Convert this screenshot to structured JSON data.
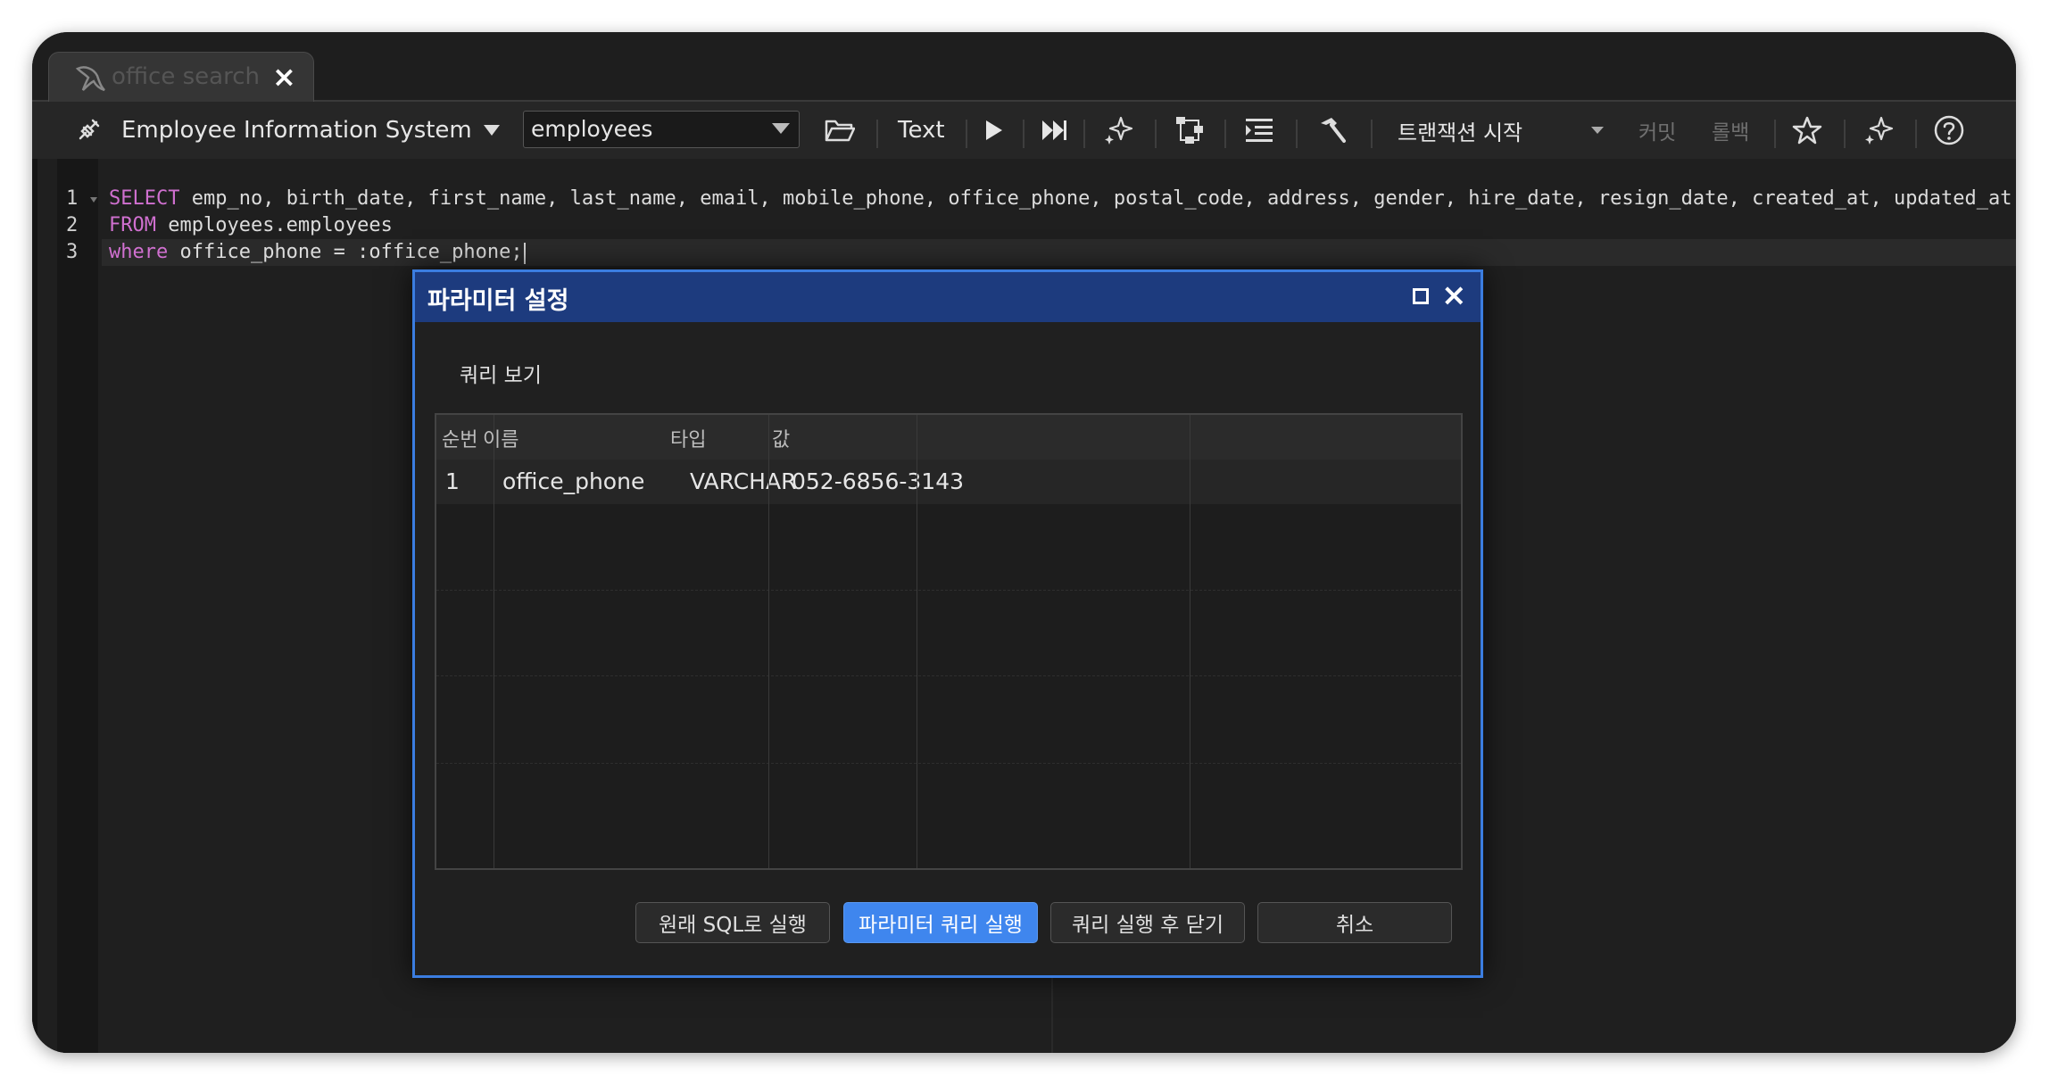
{
  "tab": {
    "title": "office search",
    "icon": "dolphin-icon"
  },
  "toolbar": {
    "connection": "Employee Information System",
    "database": "employees",
    "format": "Text",
    "transaction": "트랜잭션 시작",
    "commit": "커밋",
    "rollback": "롤백"
  },
  "editor": {
    "lines": [
      {
        "num": "1",
        "kw": "SELECT",
        "rest": " emp_no, birth_date, first_name, last_name, email, mobile_phone, office_phone, postal_code, address, gender, hire_date, resign_date, created_at, updated_at"
      },
      {
        "num": "2",
        "kw": "FROM",
        "rest": " employees.employees"
      },
      {
        "num": "3",
        "kw": "where",
        "rest": " office_phone = :office_phone;"
      }
    ]
  },
  "dialog": {
    "title": "파라미터 설정",
    "query_view_label": "쿼리 보기",
    "columns": [
      "순번",
      "이름",
      "타입",
      "값",
      ""
    ],
    "rows": [
      {
        "seq": "1",
        "name": "office_phone",
        "type": "VARCHAR",
        "value": "052-6856-3143"
      }
    ],
    "buttons": {
      "run_original": "원래 SQL로 실행",
      "run_param": "파라미터 쿼리 실행",
      "run_close": "쿼리 실행 후 닫기",
      "cancel": "취소"
    }
  },
  "colors": {
    "accent": "#3f86ee",
    "dialog_title_bg": "#1d3b7e",
    "keyword": "#d070d0"
  }
}
